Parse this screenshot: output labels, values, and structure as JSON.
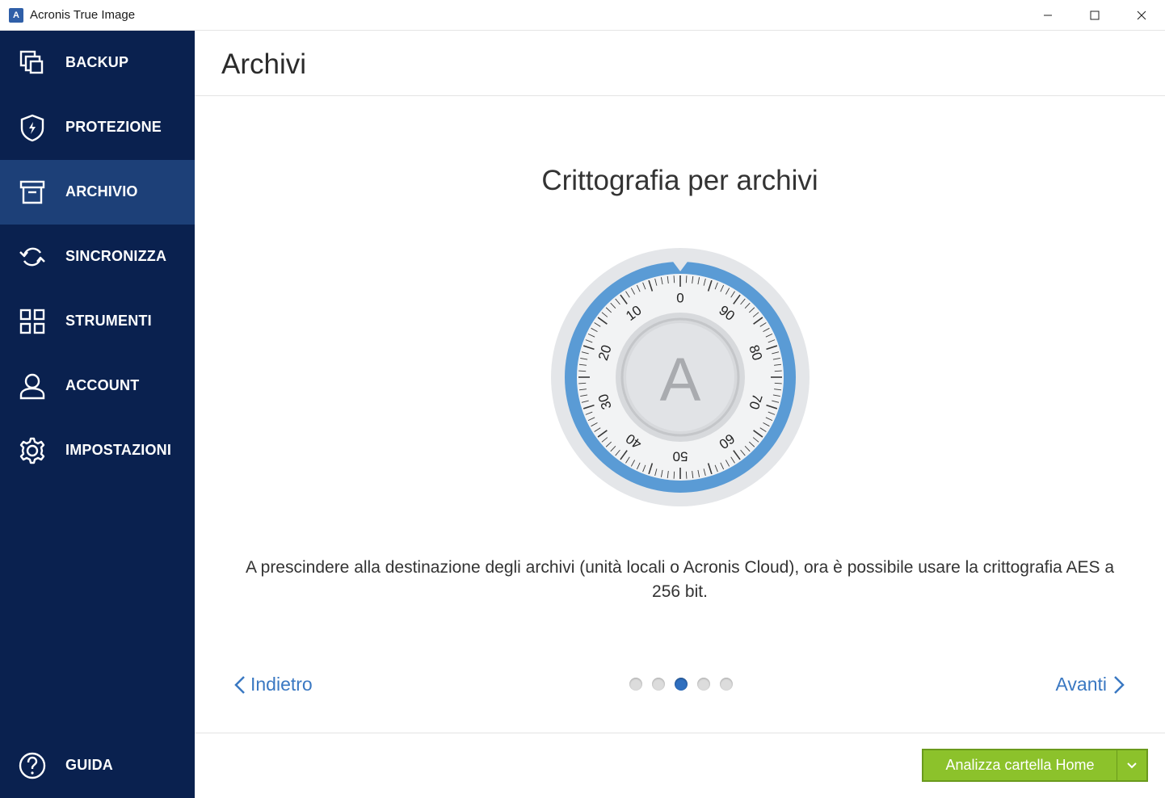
{
  "window": {
    "title": "Acronis True Image",
    "logo_letter": "A"
  },
  "sidebar": {
    "items": [
      {
        "label": "BACKUP",
        "icon": "backup-icon"
      },
      {
        "label": "PROTEZIONE",
        "icon": "shield-icon"
      },
      {
        "label": "ARCHIVIO",
        "icon": "archive-icon",
        "active": true
      },
      {
        "label": "SINCRONIZZA",
        "icon": "sync-icon"
      },
      {
        "label": "STRUMENTI",
        "icon": "tools-grid-icon"
      },
      {
        "label": "ACCOUNT",
        "icon": "user-icon"
      },
      {
        "label": "IMPOSTAZIONI",
        "icon": "gear-icon"
      }
    ],
    "help": {
      "label": "GUIDA",
      "icon": "help-icon"
    }
  },
  "main": {
    "page_title": "Archivi",
    "slide": {
      "title": "Crittografia per archivi",
      "description": "A prescindere alla destinazione degli archivi (unità locali o Acronis Cloud), ora è possibile usare la crittografia AES a 256 bit.",
      "dial_letter": "A",
      "dial_numbers": [
        "0",
        "10",
        "20",
        "30",
        "40",
        "50",
        "60",
        "70",
        "80",
        "90"
      ]
    },
    "pager": {
      "total": 5,
      "current": 3
    },
    "back_label": "Indietro",
    "next_label": "Avanti"
  },
  "action": {
    "label": "Analizza cartella Home"
  },
  "colors": {
    "sidebar_bg": "#0a214f",
    "sidebar_active": "#1d4078",
    "accent_blue": "#3a78c2",
    "dial_ring": "#5a9bd5",
    "action_green": "#8cc22b"
  }
}
